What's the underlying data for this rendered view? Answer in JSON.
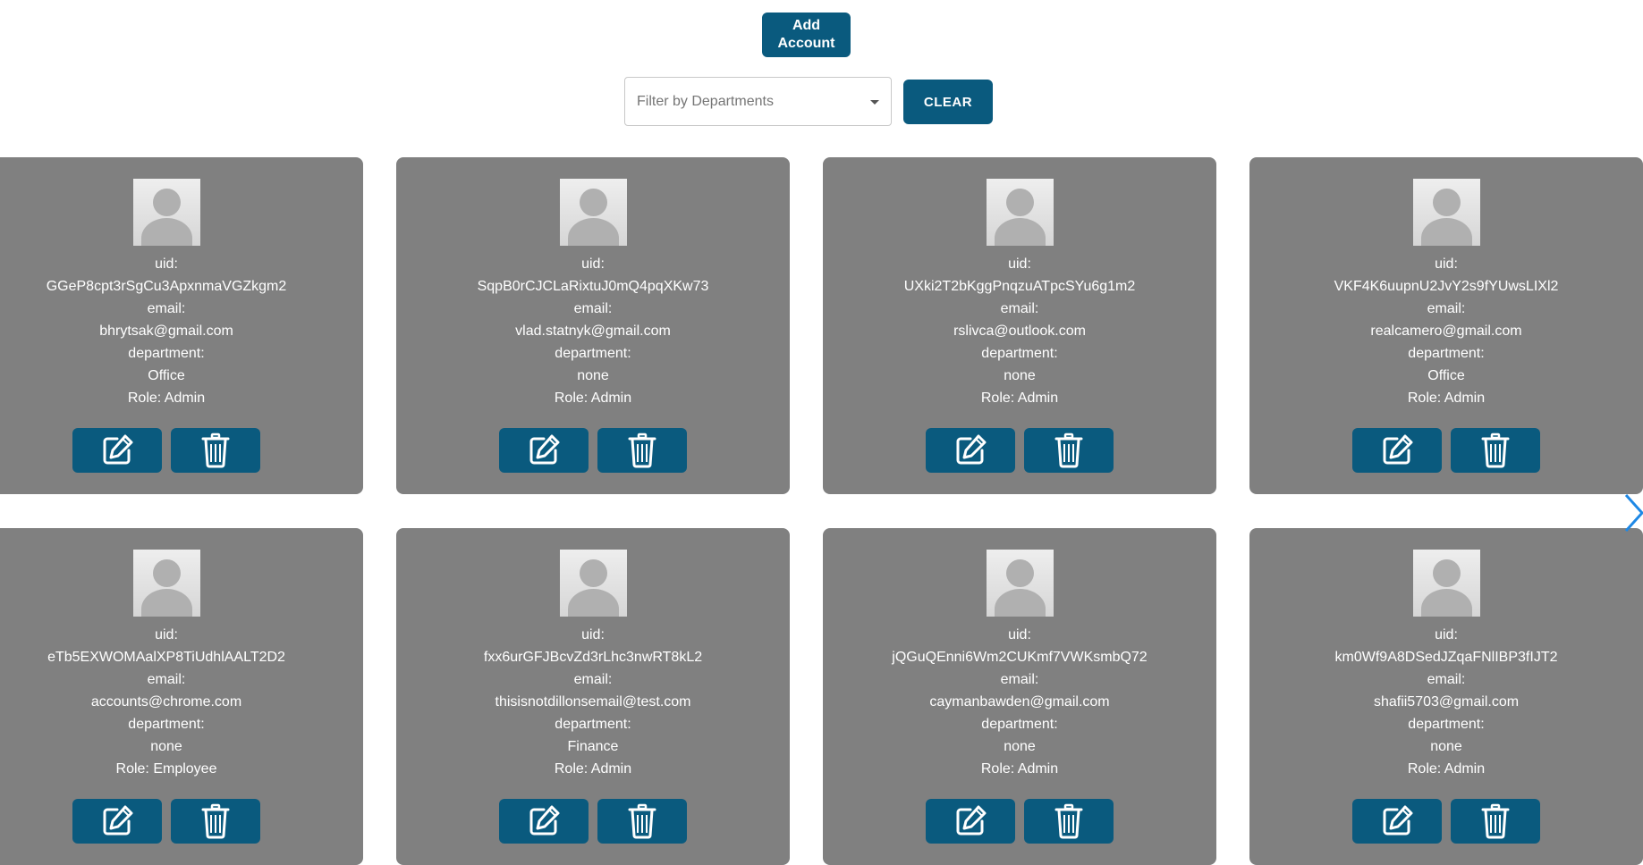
{
  "toolbar": {
    "add_account_label": "Add Account",
    "filter_placeholder": "Filter by Departments",
    "clear_label": "CLEAR"
  },
  "labels": {
    "uid": "uid:",
    "email": "email:",
    "department": "department:"
  },
  "accounts": [
    {
      "uid": "GGeP8cpt3rSgCu3ApxnmaVGZkgm2",
      "email": "bhrytsak@gmail.com",
      "department": "Office",
      "role": "Role: Admin"
    },
    {
      "uid": "SqpB0rCJCLaRixtuJ0mQ4pqXKw73",
      "email": "vlad.statnyk@gmail.com",
      "department": "none",
      "role": "Role: Admin"
    },
    {
      "uid": "UXki2T2bKggPnqzuATpcSYu6g1m2",
      "email": "rslivca@outlook.com",
      "department": "none",
      "role": "Role: Admin"
    },
    {
      "uid": "VKF4K6uupnU2JvY2s9fYUwsLIXl2",
      "email": "realcamero@gmail.com",
      "department": "Office",
      "role": "Role: Admin"
    },
    {
      "uid": "eTb5EXWOMAalXP8TiUdhlAALT2D2",
      "email": "accounts@chrome.com",
      "department": "none",
      "role": "Role: Employee"
    },
    {
      "uid": "fxx6urGFJBcvZd3rLhc3nwRT8kL2",
      "email": "thisisnotdillonsemail@test.com",
      "department": "Finance",
      "role": "Role: Admin"
    },
    {
      "uid": "jQGuQEnni6Wm2CUKmf7VWKsmbQ72",
      "email": "caymanbawden@gmail.com",
      "department": "none",
      "role": "Role: Admin"
    },
    {
      "uid": "km0Wf9A8DSedJZqaFNlIBP3fIJT2",
      "email": "shafii5703@gmail.com",
      "department": "none",
      "role": "Role: Admin"
    }
  ],
  "colors": {
    "primary_button": "#0a5a7e",
    "card_background": "#808080",
    "carousel_arrow": "#1e88e5"
  },
  "icons": {
    "edit": "edit-icon",
    "delete": "trash-icon",
    "avatar": "user-avatar-placeholder",
    "next": "chevron-right-icon"
  }
}
